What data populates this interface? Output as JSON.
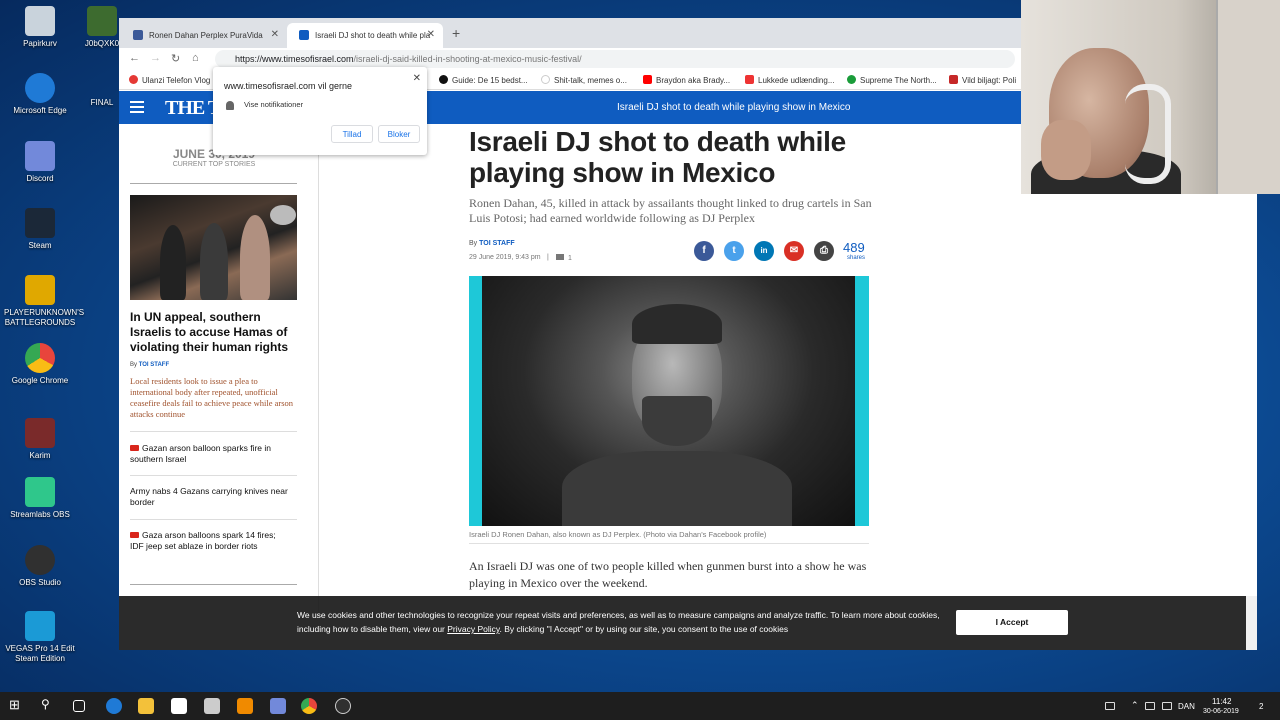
{
  "desktop": {
    "icons": [
      {
        "label": "Papirkurv",
        "color": "#c9d3dc"
      },
      {
        "label": "Microsoft Edge",
        "color": "#1f7ad6"
      },
      {
        "label": "Discord",
        "color": "#7289da"
      },
      {
        "label": "Steam",
        "color": "#1b2838"
      },
      {
        "label": "PLAYERUNKNOWN'S BATTLEGROUNDS",
        "color": "#e0a800"
      },
      {
        "label": "Google Chrome",
        "color": "#e8453c"
      },
      {
        "label": "Karim",
        "color": "#7a2a2a"
      },
      {
        "label": "Streamlabs OBS",
        "color": "#2fc78b"
      },
      {
        "label": "OBS Studio",
        "color": "#303030"
      },
      {
        "label": "VEGAS Pro 14 Edit Steam Edition",
        "color": "#1b9ad6"
      }
    ],
    "col2": [
      {
        "label": "J0bQXK0"
      },
      {
        "label": "FINAL"
      }
    ]
  },
  "browser": {
    "tabs": [
      {
        "title": "Ronen Dahan Perplex PuraVida",
        "fav_color": "#3b5998"
      },
      {
        "title": "Israeli DJ shot to death while pla",
        "fav_color": "#0f5cc0"
      }
    ],
    "url_domain": "https://www.timesofisrael.com",
    "url_path": "/israeli-dj-said-killed-in-shooting-at-mexico-music-festival/",
    "bookmarks": [
      {
        "label": "Ulanzi Telefon Vlog",
        "color": "#e53935"
      },
      {
        "label": "Guide: De 15 bedst...",
        "color": "#111111"
      },
      {
        "label": "Shit-talk, memes o...",
        "color": "#ffffff"
      },
      {
        "label": "Braydon aka Brady...",
        "color": "#ff0000"
      },
      {
        "label": "Lukkede udlænding...",
        "color": "#e33"
      },
      {
        "label": "Supreme The North...",
        "color": "#1a9c3a"
      },
      {
        "label": "Vild biljagt: Poli",
        "color": "#c62828"
      }
    ]
  },
  "popup": {
    "site": "www.timesofisrael.com vil gerne",
    "notif": "Vise notifikationer",
    "allow": "Tillad",
    "block": "Bloker"
  },
  "site": {
    "logo": "THE TI",
    "header_title": "Israeli DJ shot to death while playing show in Mexico"
  },
  "sidebar": {
    "date": "JUNE 30, 2019",
    "caption": "CURRENT TOP STORIES",
    "headline": "In UN appeal, southern Israelis to accuse Hamas of violating their human rights",
    "by": "By",
    "author": "TOI STAFF",
    "desc": "Local residents look to issue a plea to international body after repeated, unofficial ceasefire deals fail to achieve peace while arson attacks continue",
    "items": [
      {
        "text": "Gazan arson balloon sparks fire in southern Israel",
        "video": true
      },
      {
        "text": "Army nabs 4 Gazans carrying knives near border",
        "video": false
      },
      {
        "text": "Gaza arson balloons spark 14 fires; IDF jeep set ablaze in border riots",
        "video": true
      }
    ]
  },
  "article": {
    "title": "Israeli DJ shot to death while playing show in Mexico",
    "subtitle": "Ronen Dahan, 45, killed in attack by assailants thought linked to drug cartels in San Luis Potosi; had earned worldwide following as DJ Perplex",
    "by": "By",
    "author": "TOI STAFF",
    "date": "29 June 2019, 9:43 pm",
    "sep": "|",
    "comments": "1",
    "shares_count": "489",
    "shares_label": "shares",
    "caption": "Israeli DJ Ronen Dahan, also known as DJ Perplex. (Photo via Dahan's Facebook profile)",
    "body": "An Israeli DJ was one of two people killed when gunmen burst into a show he was playing in Mexico over the weekend."
  },
  "share": [
    {
      "glyph": "f",
      "color": "#3b5998"
    },
    {
      "glyph": "t",
      "color": "#4aa1eb"
    },
    {
      "glyph": "in",
      "color": "#0077b5"
    },
    {
      "glyph": "✉",
      "color": "#d93025"
    },
    {
      "glyph": "⎙",
      "color": "#444444"
    }
  ],
  "cookie": {
    "text_a": "We use cookies and other technologies to recognize your repeat visits and preferences, as well as to measure campaigns and analyze traffic. To learn more about cookies, including how to disable them, view our ",
    "link": "Privacy Policy",
    "text_b": ". By clicking \"I Accept\" or by using our site, you consent to the use of cookies",
    "button": "I Accept"
  },
  "taskbar": {
    "lang": "DAN",
    "time": "11:42",
    "date": "30-06-2019",
    "notif": "2"
  }
}
